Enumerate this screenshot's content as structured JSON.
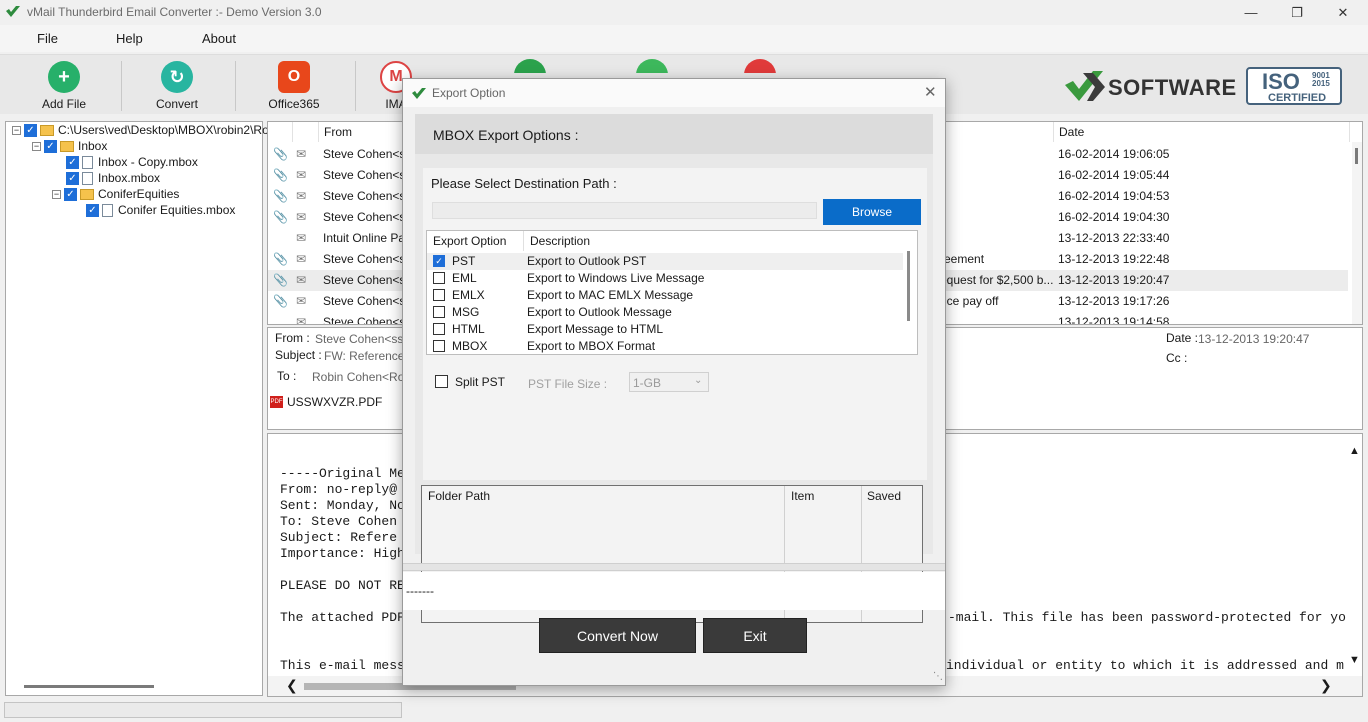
{
  "window": {
    "title": "vMail Thunderbird Email Converter  :- Demo Version 3.0"
  },
  "menu": [
    "File",
    "Help",
    "About"
  ],
  "toolbar": {
    "buttons": [
      "Add File",
      "Convert",
      "Office365",
      "IMA"
    ],
    "brand_text": "SOFTWARE",
    "iso_text": "ISO",
    "iso_years": "9001 2015",
    "iso_certified": "CERTIFIED"
  },
  "tree": {
    "root": "C:\\Users\\ved\\Desktop\\MBOX\\robin2\\Ro",
    "inbox": "Inbox",
    "inbox_copy": "Inbox - Copy.mbox",
    "inbox_mbox": "Inbox.mbox",
    "conifer": "ConiferEquities",
    "conifer_mbox": "Conifer Equities.mbox"
  },
  "list": {
    "col_from": "From",
    "col_date": "Date",
    "rows": [
      {
        "from": "Steve Cohen<ssc",
        "subject": "",
        "date": "16-02-2014 19:06:05"
      },
      {
        "from": "Steve Cohen<ssc",
        "subject": "",
        "date": "16-02-2014 19:05:44"
      },
      {
        "from": "Steve Cohen<ssc",
        "subject": "",
        "date": "16-02-2014 19:04:53"
      },
      {
        "from": "Steve Cohen<ssc",
        "subject": "",
        "date": "16-02-2014 19:04:30"
      },
      {
        "from": "Intuit Online Payr",
        "subject": "",
        "date": "13-12-2013 22:33:40"
      },
      {
        "from": "Steve Cohen<ssc",
        "subject": "reement",
        "date": "13-12-2013 19:22:48"
      },
      {
        "from": "Steve Cohen<ssc",
        "subject": "equest for $2,500 b...",
        "date": "13-12-2013 19:20:47"
      },
      {
        "from": "Steve Cohen<ssc",
        "subject": "nce pay off",
        "date": "13-12-2013 19:17:26"
      },
      {
        "from": "Steve Cohen<ssc",
        "subject": "",
        "date": "13-12-2013 19:14:58"
      }
    ]
  },
  "preview": {
    "from_label": "From :",
    "from_value": "Steve Cohen<ssc",
    "subject_label": "Subject :",
    "subject_value": "FW: Reference N",
    "to_label": "To :",
    "to_value": "Robin Cohen<Robin",
    "date_label": "Date :",
    "date_value": "13-12-2013 19:20:47",
    "cc_label": "Cc :",
    "attachment": "USSWXVZR.PDF",
    "body_left": [
      "-----Original Me",
      "From: no-reply@",
      "Sent: Monday, No",
      "To: Steve Cohen",
      "Subject: Refere",
      "Importance: High",
      "",
      "PLEASE DO NOT RE",
      "",
      "The attached PDF",
      "",
      "",
      "This e-mail mess"
    ],
    "body_right1": "-mail. This file has been password-protected for yo",
    "body_right2": "individual or entity to which it is addressed and m"
  },
  "dialog": {
    "title": "Export Option",
    "heading": "MBOX Export Options :",
    "dest_label": "Please Select Destination Path :",
    "browse": "Browse",
    "col_option": "Export Option",
    "col_desc": "Description",
    "options": [
      {
        "name": "PST",
        "desc": "Export to Outlook PST",
        "checked": true
      },
      {
        "name": "EML",
        "desc": "Export to Windows Live Message",
        "checked": false
      },
      {
        "name": "EMLX",
        "desc": "Export to MAC EMLX Message",
        "checked": false
      },
      {
        "name": "MSG",
        "desc": "Export to Outlook Message",
        "checked": false
      },
      {
        "name": "HTML",
        "desc": "Export Message to HTML",
        "checked": false
      },
      {
        "name": "MBOX",
        "desc": "Export to MBOX Format",
        "checked": false
      }
    ],
    "split_label": "Split PST",
    "size_label": "PST File Size :",
    "size_value": "1-GB",
    "result_cols": [
      "Folder Path",
      "Item",
      "Saved"
    ],
    "progress_text": "-------",
    "convert_btn": "Convert Now",
    "exit_btn": "Exit"
  }
}
